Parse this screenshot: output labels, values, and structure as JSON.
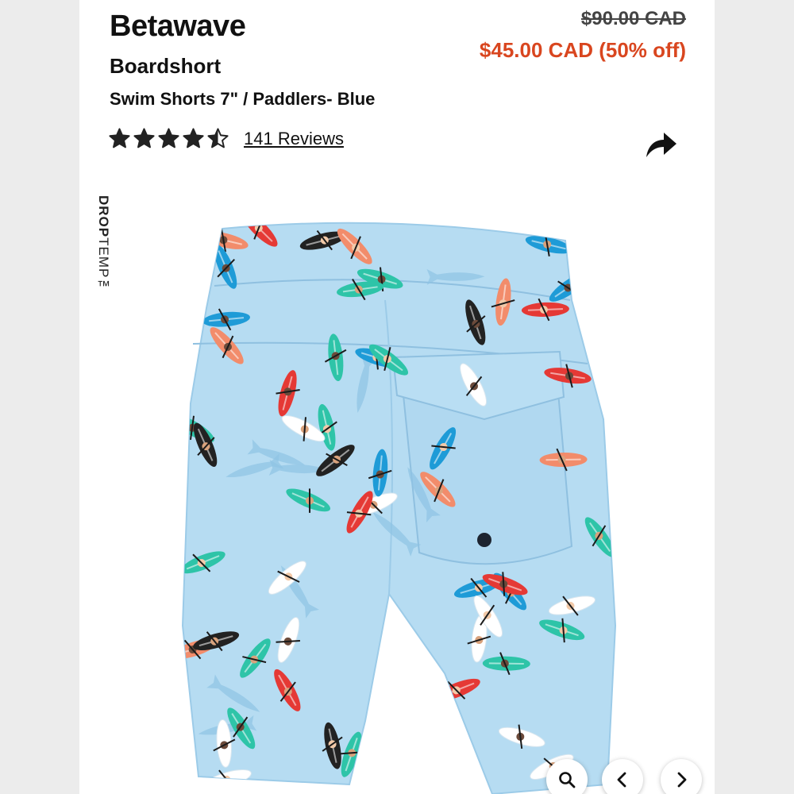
{
  "product": {
    "brand": "Betawave",
    "type": "Boardshort",
    "variant": "Swim Shorts 7\" / Paddlers- Blue",
    "original_price": "$90.00 CAD",
    "sale_price": "$45.00 CAD (50% off)",
    "rating": 4.5,
    "reviews_label": "141 Reviews"
  },
  "image": {
    "badge_bold": "DROP",
    "badge_light": "TEMP™",
    "print_colors": [
      "#e53935",
      "#1e9bd7",
      "#2ec4a8",
      "#222222",
      "#f28c6b",
      "#ffffff"
    ]
  },
  "controls": {
    "zoom": "magnifier-icon",
    "prev": "chevron-left-icon",
    "next": "chevron-right-icon",
    "share": "share-arrow-icon"
  },
  "colors": {
    "sale": "#d9461f",
    "fabric": "#b6dcf2",
    "text": "#111111"
  }
}
